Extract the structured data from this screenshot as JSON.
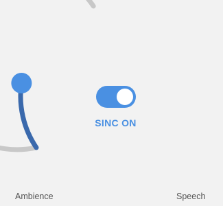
{
  "colors": {
    "background": "#f2f2f2",
    "track": "#c8c8c8",
    "fill": "#3a69ac",
    "handle": "#4a90e2",
    "toggle_on": "#4a90e2",
    "label_text": "#555555",
    "status_text": "#4a90e2"
  },
  "dial": {
    "value_fraction": 0.17,
    "handle_icon": "circle-handle-icon"
  },
  "toggle": {
    "state": "on",
    "label": "SINC ON"
  },
  "labels": {
    "left": "Ambience",
    "right": "Speech"
  }
}
